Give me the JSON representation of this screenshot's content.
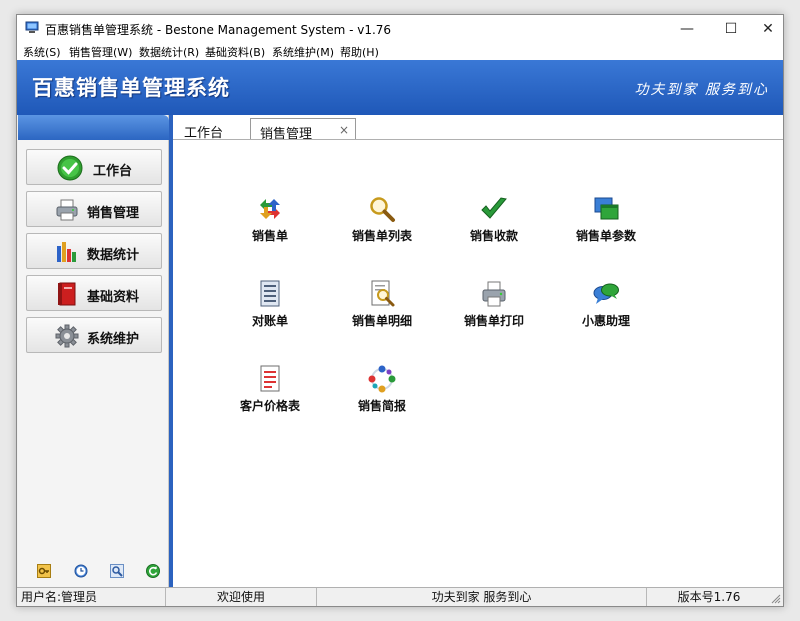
{
  "window": {
    "title": "百惠销售单管理系统 - Bestone Management System - v1.76",
    "minimize_glyph": "—",
    "maximize_glyph": "☐",
    "close_glyph": "✕"
  },
  "menu": {
    "items": [
      "系统(S)",
      "销售管理(W)",
      "数据统计(R)",
      "基础资料(B)",
      "系统维护(M)",
      "帮助(H)"
    ]
  },
  "banner": {
    "title": "百惠销售单管理系统",
    "slogan": "功夫到家 服务到心"
  },
  "sidebar": {
    "items": [
      {
        "label": "工作台",
        "icon": "check-circle-icon"
      },
      {
        "label": "销售管理",
        "icon": "printer-icon"
      },
      {
        "label": "数据统计",
        "icon": "bar-chart-icon"
      },
      {
        "label": "基础资料",
        "icon": "book-icon"
      },
      {
        "label": "系统维护",
        "icon": "gear-icon"
      }
    ],
    "tools": [
      "key-icon",
      "clock-icon",
      "search-icon",
      "refresh-icon"
    ]
  },
  "tabs": {
    "workbench": "工作台",
    "sales": "销售管理",
    "close_glyph": "×"
  },
  "grid": {
    "items": [
      {
        "label": "销售单",
        "icon": "recycle-arrows-icon"
      },
      {
        "label": "销售单列表",
        "icon": "magnifier-icon"
      },
      {
        "label": "销售收款",
        "icon": "checkmark-icon"
      },
      {
        "label": "销售单参数",
        "icon": "window-stack-icon"
      },
      {
        "label": "对账单",
        "icon": "document-icon"
      },
      {
        "label": "销售单明细",
        "icon": "document-search-icon"
      },
      {
        "label": "销售单打印",
        "icon": "printer-icon"
      },
      {
        "label": "小惠助理",
        "icon": "chat-bubbles-icon"
      },
      {
        "label": "客户价格表",
        "icon": "price-list-icon"
      },
      {
        "label": "销售简报",
        "icon": "circle-report-icon"
      }
    ]
  },
  "status": {
    "user": "用户名:管理员",
    "welcome": "欢迎使用",
    "slogan": "功夫到家 服务到心",
    "version": "版本号1.76"
  },
  "colors": {
    "banner": "#2a64c6",
    "accent": "#2b62bf"
  }
}
